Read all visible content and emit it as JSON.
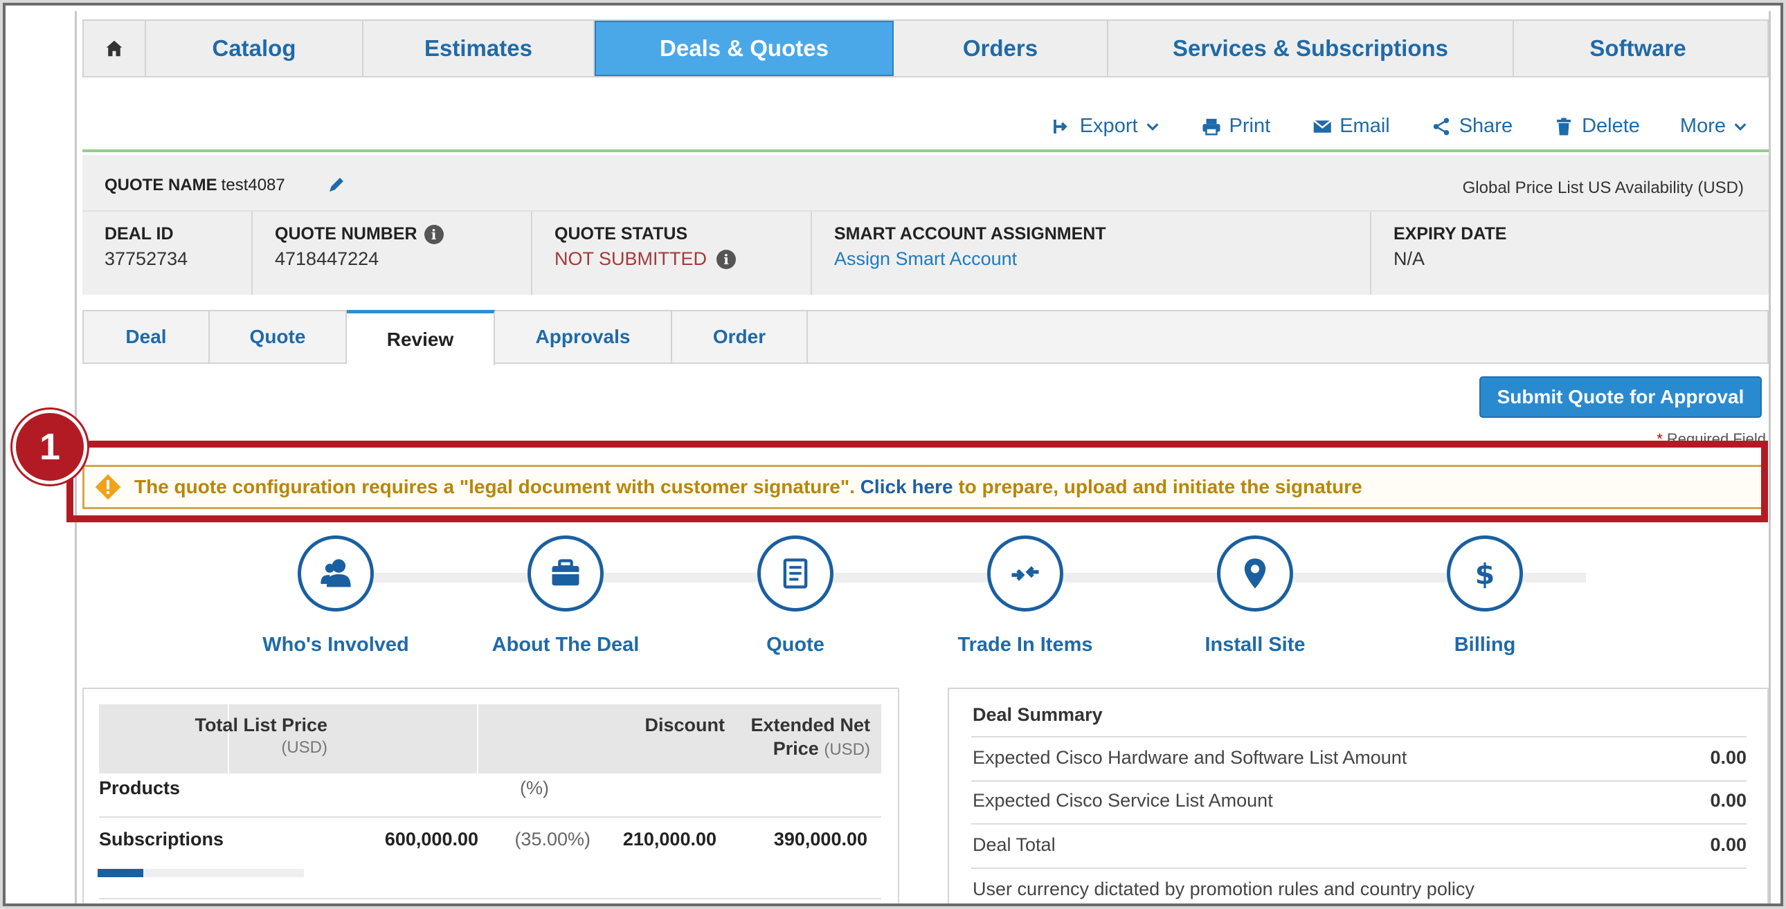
{
  "top_nav": {
    "home_icon": "home-icon",
    "tabs": [
      "Catalog",
      "Estimates",
      "Deals & Quotes",
      "Orders",
      "Services & Subscriptions",
      "Software"
    ],
    "active_tab": "Deals & Quotes"
  },
  "actions": {
    "export": "Export",
    "print": "Print",
    "email": "Email",
    "share": "Share",
    "delete": "Delete",
    "more": "More"
  },
  "quote": {
    "name_label": "QUOTE NAME",
    "name_value": "test4087",
    "price_list": "Global Price List US Availability (USD)",
    "deal_id_label": "DEAL ID",
    "deal_id": "37752734",
    "quote_number_label": "QUOTE NUMBER",
    "quote_number": "4718447224",
    "quote_status_label": "QUOTE STATUS",
    "quote_status": "NOT SUBMITTED",
    "smart_account_label": "SMART ACCOUNT ASSIGNMENT",
    "smart_account_link": "Assign Smart Account",
    "expiry_label": "EXPIRY DATE",
    "expiry_value": "N/A"
  },
  "sub_tabs": [
    "Deal",
    "Quote",
    "Review",
    "Approvals",
    "Order"
  ],
  "active_sub_tab": "Review",
  "submit_button": "Submit Quote for Approval",
  "required_field": "Required Field",
  "required_star": "*",
  "warning": {
    "text_before": "The quote configuration requires a \"legal document with customer signature\". ",
    "link": "Click here",
    "text_after": " to prepare, upload and initiate the signature"
  },
  "steps": [
    "Who's Involved",
    "About The Deal",
    "Quote",
    "Trade In Items",
    "Install Site",
    "Billing"
  ],
  "price_table": {
    "headers": {
      "total_list_price": "Total List Price",
      "total_list_price_unit": "(USD)",
      "discount": "Discount",
      "extended_net_price_line1": "Extended Net",
      "extended_net_price_line2": "Price",
      "extended_net_price_unit": "(USD)"
    },
    "rows": [
      {
        "label": "Products",
        "list_price": "",
        "discount_pct": "(%)",
        "discount": "",
        "net_price": ""
      },
      {
        "label": "Subscriptions",
        "list_price": "600,000.00",
        "discount_pct": "(35.00%)",
        "discount": "210,000.00",
        "net_price": "390,000.00"
      }
    ],
    "subscriptions_progress": 0.22
  },
  "deal_summary": {
    "title": "Deal Summary",
    "rows": [
      {
        "label": "Expected Cisco Hardware and Software List Amount",
        "value": "0.00"
      },
      {
        "label": "Expected Cisco Service List Amount",
        "value": "0.00"
      },
      {
        "label": "Deal Total",
        "value": "0.00"
      }
    ],
    "note": "User currency dictated by promotion rules and country policy"
  },
  "annotation": {
    "number": "1",
    "color": "#b31b24"
  }
}
